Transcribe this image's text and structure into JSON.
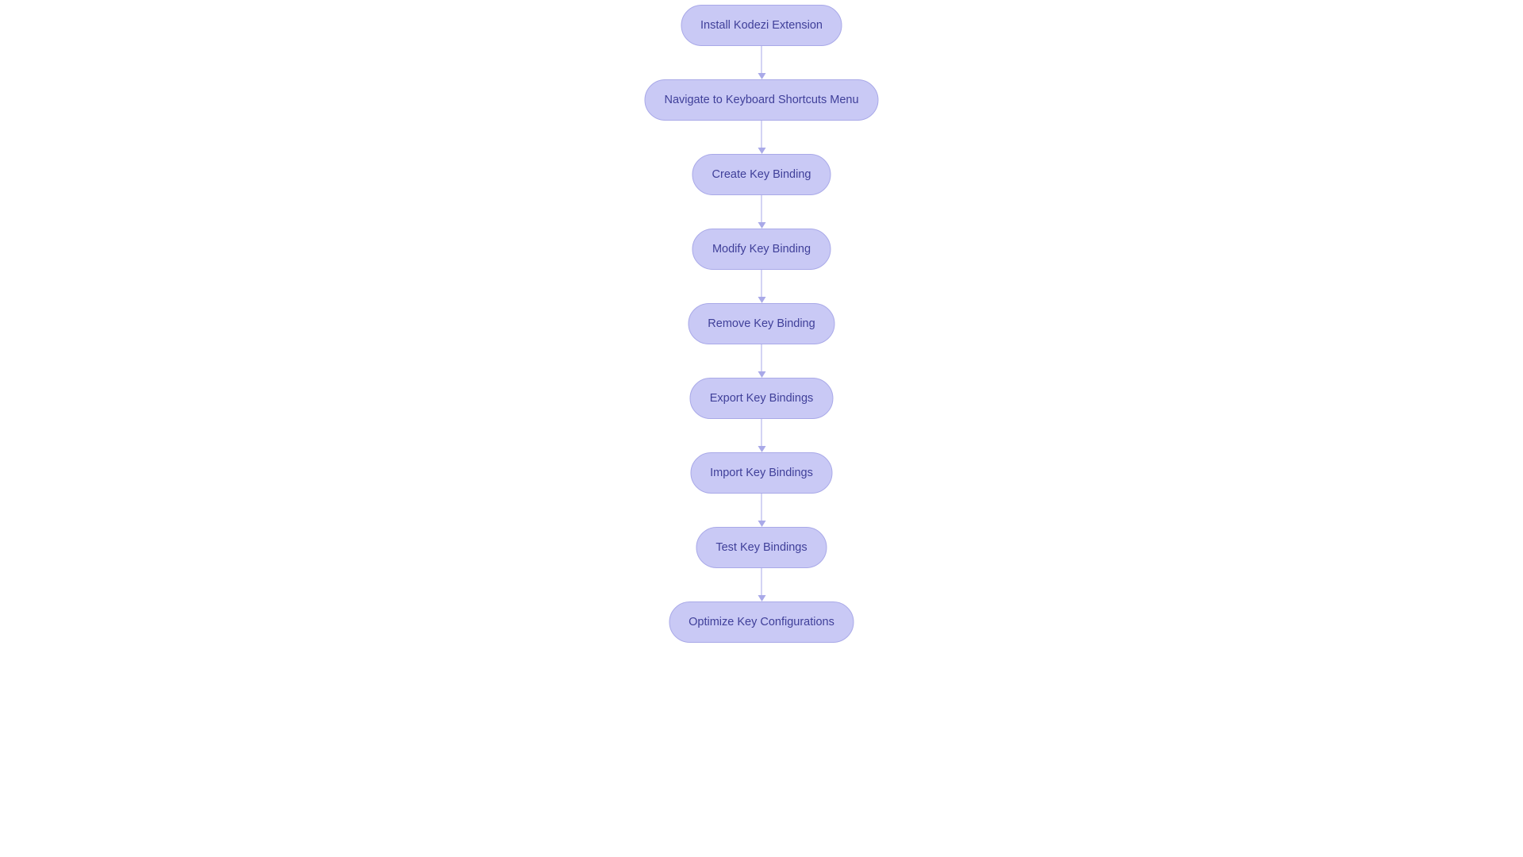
{
  "flowchart": {
    "nodes": [
      {
        "label": "Install Kodezi Extension"
      },
      {
        "label": "Navigate to Keyboard Shortcuts Menu"
      },
      {
        "label": "Create Key Binding"
      },
      {
        "label": "Modify Key Binding"
      },
      {
        "label": "Remove Key Binding"
      },
      {
        "label": "Export Key Bindings"
      },
      {
        "label": "Import Key Bindings"
      },
      {
        "label": "Test Key Bindings"
      },
      {
        "label": "Optimize Key Configurations"
      }
    ]
  },
  "colors": {
    "node_fill": "#c9c9f5",
    "node_border": "#a9a9e8",
    "text": "#3f3f99",
    "connector": "#a9a9e8"
  }
}
